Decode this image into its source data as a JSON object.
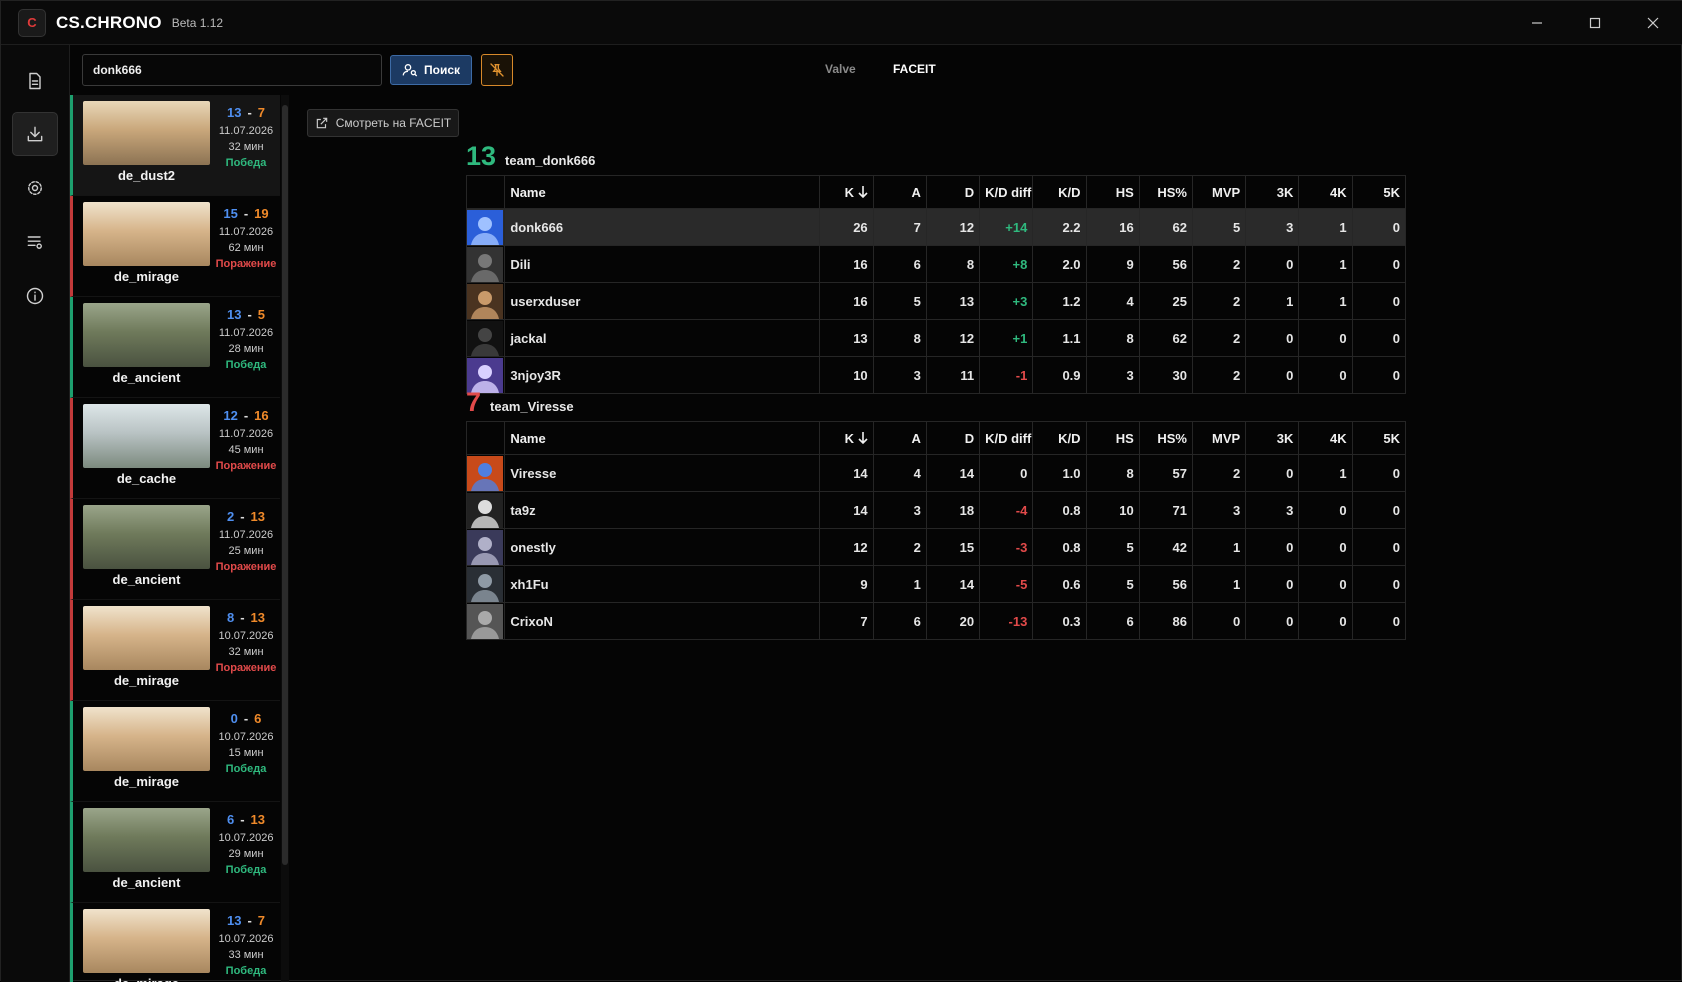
{
  "app": {
    "title": "CS.CHRONO",
    "version": "Beta 1.12"
  },
  "search": {
    "value": "donk666",
    "button_label": "Поиск"
  },
  "sources": {
    "valve": "Valve",
    "faceit": "FACEIT"
  },
  "faceit_link": "Смотреть на FACEIT",
  "columns": [
    "Name",
    "K",
    "A",
    "D",
    "K/D diff",
    "K/D",
    "HS",
    "HS%",
    "MVP",
    "3K",
    "4K",
    "5K"
  ],
  "matches": [
    {
      "map": "de_dust2",
      "score_a": "13",
      "score_b": "7",
      "date": "11.07.2026",
      "duration": "32 мин",
      "result": "Победа",
      "win": true
    },
    {
      "map": "de_mirage",
      "score_a": "15",
      "score_b": "19",
      "date": "11.07.2026",
      "duration": "62 мин",
      "result": "Поражение",
      "win": false
    },
    {
      "map": "de_ancient",
      "score_a": "13",
      "score_b": "5",
      "date": "11.07.2026",
      "duration": "28 мин",
      "result": "Победа",
      "win": true
    },
    {
      "map": "de_cache",
      "score_a": "12",
      "score_b": "16",
      "date": "11.07.2026",
      "duration": "45 мин",
      "result": "Поражение",
      "win": false
    },
    {
      "map": "de_ancient",
      "score_a": "2",
      "score_b": "13",
      "date": "11.07.2026",
      "duration": "25 мин",
      "result": "Поражение",
      "win": false
    },
    {
      "map": "de_mirage",
      "score_a": "8",
      "score_b": "13",
      "date": "10.07.2026",
      "duration": "32 мин",
      "result": "Поражение",
      "win": false
    },
    {
      "map": "de_mirage",
      "score_a": "0",
      "score_b": "6",
      "date": "10.07.2026",
      "duration": "15 мин",
      "result": "Победа",
      "win": true
    },
    {
      "map": "de_ancient",
      "score_a": "6",
      "score_b": "13",
      "date": "10.07.2026",
      "duration": "29 мин",
      "result": "Победа",
      "win": true
    },
    {
      "map": "de_mirage",
      "score_a": "13",
      "score_b": "7",
      "date": "10.07.2026",
      "duration": "33 мин",
      "result": "Победа",
      "win": true
    }
  ],
  "teams": [
    {
      "score": "13",
      "name": "team_donk666",
      "color": "#2fb97e",
      "players": [
        {
          "name": "donk666",
          "k": "26",
          "a": "7",
          "d": "12",
          "kd_diff": "+14",
          "kd": "2.2",
          "hs": "16",
          "hs_pct": "62",
          "mvp": "5",
          "k3": "3",
          "k4": "1",
          "k5": "0",
          "highlight": true
        },
        {
          "name": "Dili",
          "k": "16",
          "a": "6",
          "d": "8",
          "kd_diff": "+8",
          "kd": "2.0",
          "hs": "9",
          "hs_pct": "56",
          "mvp": "2",
          "k3": "0",
          "k4": "1",
          "k5": "0"
        },
        {
          "name": "userxduser",
          "k": "16",
          "a": "5",
          "d": "13",
          "kd_diff": "+3",
          "kd": "1.2",
          "hs": "4",
          "hs_pct": "25",
          "mvp": "2",
          "k3": "1",
          "k4": "1",
          "k5": "0"
        },
        {
          "name": "jackal",
          "k": "13",
          "a": "8",
          "d": "12",
          "kd_diff": "+1",
          "kd": "1.1",
          "hs": "8",
          "hs_pct": "62",
          "mvp": "2",
          "k3": "0",
          "k4": "0",
          "k5": "0"
        },
        {
          "name": "3njoy3R",
          "k": "10",
          "a": "3",
          "d": "11",
          "kd_diff": "-1",
          "kd": "0.9",
          "hs": "3",
          "hs_pct": "30",
          "mvp": "2",
          "k3": "0",
          "k4": "0",
          "k5": "0"
        }
      ]
    },
    {
      "score": "7",
      "name": "team_Viresse",
      "color": "#e24a4a",
      "players": [
        {
          "name": "Viresse",
          "k": "14",
          "a": "4",
          "d": "14",
          "kd_diff": "0",
          "kd": "1.0",
          "hs": "8",
          "hs_pct": "57",
          "mvp": "2",
          "k3": "0",
          "k4": "1",
          "k5": "0"
        },
        {
          "name": "ta9z",
          "k": "14",
          "a": "3",
          "d": "18",
          "kd_diff": "-4",
          "kd": "0.8",
          "hs": "10",
          "hs_pct": "71",
          "mvp": "3",
          "k3": "3",
          "k4": "0",
          "k5": "0"
        },
        {
          "name": "onestly",
          "k": "12",
          "a": "2",
          "d": "15",
          "kd_diff": "-3",
          "kd": "0.8",
          "hs": "5",
          "hs_pct": "42",
          "mvp": "1",
          "k3": "0",
          "k4": "0",
          "k5": "0"
        },
        {
          "name": "xh1Fu",
          "k": "9",
          "a": "1",
          "d": "14",
          "kd_diff": "-5",
          "kd": "0.6",
          "hs": "5",
          "hs_pct": "56",
          "mvp": "1",
          "k3": "0",
          "k4": "0",
          "k5": "0"
        },
        {
          "name": "CrixoN",
          "k": "7",
          "a": "6",
          "d": "20",
          "kd_diff": "-13",
          "kd": "0.3",
          "hs": "6",
          "hs_pct": "86",
          "mvp": "0",
          "k3": "0",
          "k4": "0",
          "k5": "0"
        }
      ]
    }
  ]
}
